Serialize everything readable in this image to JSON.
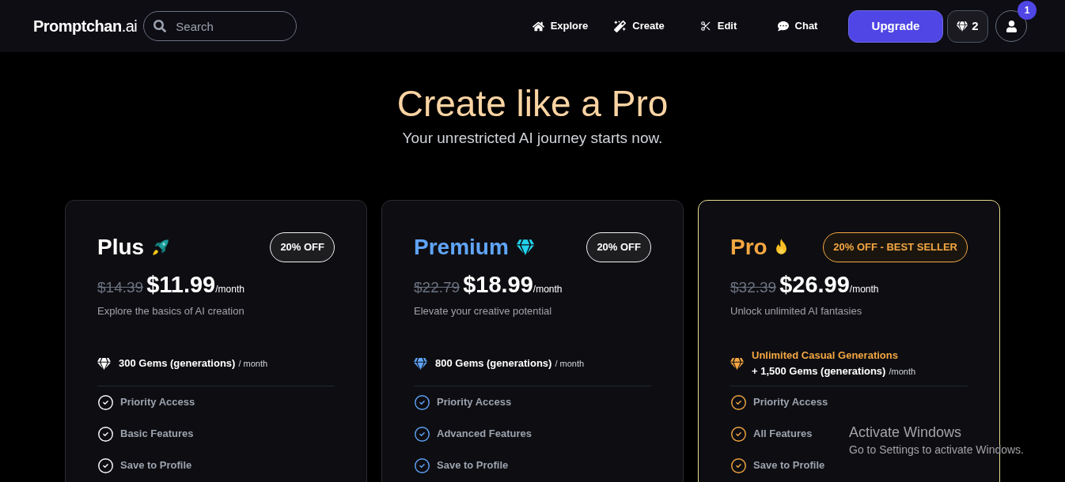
{
  "header": {
    "logo": "**Promptchan**.ai",
    "search": {
      "placeholder": "Search"
    },
    "nav": [
      {
        "label": "Explore"
      },
      {
        "label": "Create"
      },
      {
        "label": "Edit"
      },
      {
        "label": "Chat"
      }
    ],
    "upgrade_button": "Upgrade",
    "gems_button": "2",
    "notification_count": "1"
  },
  "hero": {
    "title": "Create like a Pro",
    "subtitle": "Your unrestricted AI journey starts now."
  },
  "plans": [
    {
      "name": "Plus",
      "color": "#ffffff",
      "featured": false,
      "badge": "20% OFF",
      "old_price": "$14.39",
      "price": "$11.99",
      "period": "/month",
      "description": "Explore the basics of AI creation",
      "allowance": {
        "amount": "300 Gems (generations)",
        "period": "/ month"
      },
      "features": [
        "Priority Access",
        "Basic Features",
        "Save to Profile"
      ]
    },
    {
      "name": "Premium",
      "color": "#60a5fa",
      "featured": false,
      "badge": "20% OFF",
      "old_price": "$22.79",
      "price": "$18.99",
      "period": "/month",
      "description": "Elevate your creative potential",
      "allowance": {
        "amount": "800 Gems (generations)",
        "period": "/ month"
      },
      "features": [
        "Priority Access",
        "Advanced Features",
        "Save to Profile"
      ]
    },
    {
      "name": "Pro",
      "color": "#f5a742",
      "featured": true,
      "badge": "20% OFF - BEST SELLER",
      "old_price": "$32.39",
      "price": "$26.99",
      "period": "/month",
      "description": "Unlock unlimited AI fantasies",
      "allowance": {
        "highlight": "Unlimited Casual Generations",
        "amount": "+ 1,500 Gems (generations)",
        "period": "/month"
      },
      "features": [
        "Priority Access",
        "All Features",
        "Save to Profile"
      ]
    }
  ],
  "system_notice": {
    "title": "Activate Windows",
    "message": "Go to Settings to activate Windows."
  }
}
